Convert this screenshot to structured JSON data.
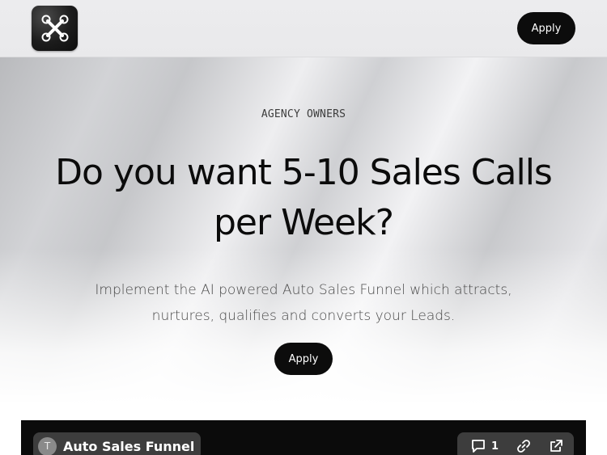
{
  "header": {
    "logo_icon": "drone-x-icon",
    "apply_label": "Apply"
  },
  "hero": {
    "eyebrow": "AGENCY OWNERS",
    "headline_line1": "Do you want 5-10 Sales Calls",
    "headline_line2": "per Week?",
    "subtext_line1": "Implement the AI powered Auto Sales Funnel which attracts,",
    "subtext_line2": "nurtures, qualifies and converts your Leads.",
    "apply_label": "Apply"
  },
  "video": {
    "avatar_letter": "T",
    "title": "Auto Sales Funnel",
    "comment_count": "1",
    "icons": [
      "comment-icon",
      "link-icon",
      "external-link-icon"
    ]
  },
  "colors": {
    "button_bg": "#0c0c0c",
    "button_text": "#ffffff",
    "video_bg": "#0b0b0b"
  }
}
